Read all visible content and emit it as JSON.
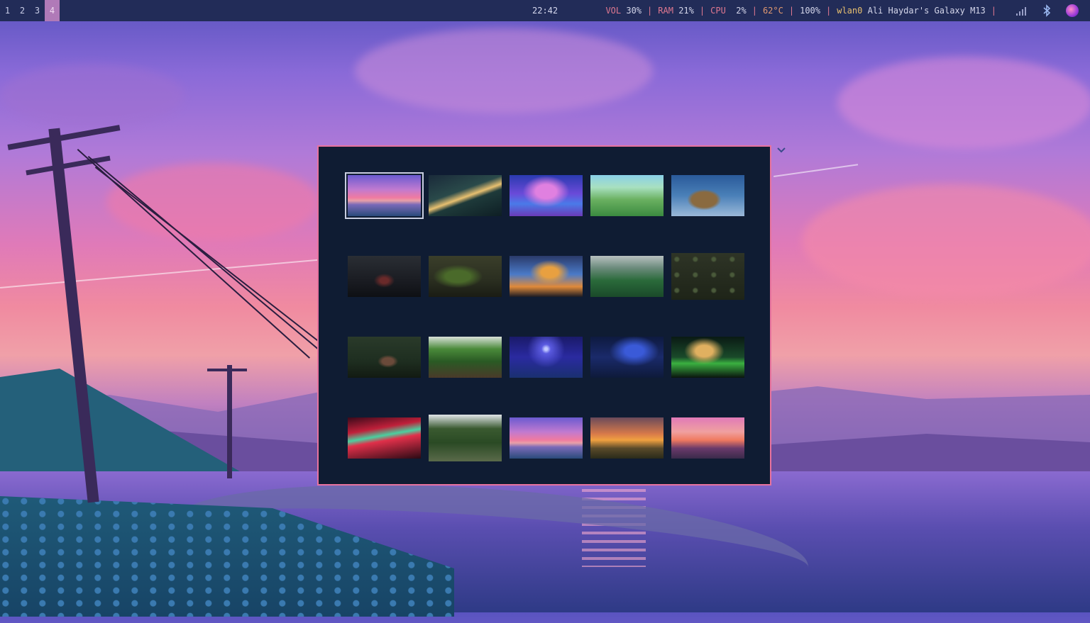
{
  "topbar": {
    "workspaces": [
      {
        "label": "1",
        "active": false
      },
      {
        "label": "2",
        "active": false
      },
      {
        "label": "3",
        "active": false
      },
      {
        "label": "4",
        "active": true
      }
    ],
    "clock": "22:42",
    "stats": {
      "vol_label": "VOL",
      "vol_value": "30%",
      "ram_label": "RAM",
      "ram_value": "21%",
      "cpu_label": "CPU",
      "cpu_value": "2%",
      "temp_value": "62°C",
      "battery_value": "100%",
      "net_iface": "wlan0",
      "net_ssid": "Ali Haydar's Galaxy M13",
      "separator": "|"
    },
    "tray_icons": [
      "wifi-signal-icon",
      "bluetooth-icon",
      "app-launcher-icon"
    ]
  },
  "picker": {
    "accent": "#e8739e",
    "background": "#0f1c33",
    "selected_index": 0,
    "thumbnails": [
      {
        "name": "sunset-power-lines"
      },
      {
        "name": "night-comet-hills"
      },
      {
        "name": "purple-cloud-field"
      },
      {
        "name": "green-village"
      },
      {
        "name": "sky-boat"
      },
      {
        "name": "dark-road-night"
      },
      {
        "name": "mossy-rock"
      },
      {
        "name": "city-skyline-clouds"
      },
      {
        "name": "misty-green-hills"
      },
      {
        "name": "dark-forest-floor"
      },
      {
        "name": "forest-cabin"
      },
      {
        "name": "pine-forest-mist"
      },
      {
        "name": "blue-moon-night"
      },
      {
        "name": "starry-river-night"
      },
      {
        "name": "aurora-clouds"
      },
      {
        "name": "red-sky-field"
      },
      {
        "name": "forest-stream"
      },
      {
        "name": "sunset-power-lines-2"
      },
      {
        "name": "orange-sunset-lake"
      },
      {
        "name": "pink-sunset-lake"
      }
    ]
  }
}
